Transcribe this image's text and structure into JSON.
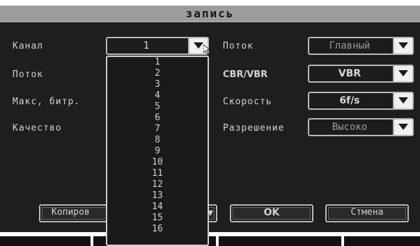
{
  "dialog": {
    "title": "запись"
  },
  "form": {
    "channel_label": "Канал",
    "channel_value": "1",
    "stream_label_left": "Поток",
    "max_bitrate_label": "Макс, битр.",
    "quality_label": "Качество",
    "stream_label_right": "Поток",
    "stream_value": "Главный",
    "cbr_vbr_label": "CBR/VBR",
    "cbr_vbr_value": "VBR",
    "speed_label": "Скорость",
    "speed_value": "6f/s",
    "resolution_label": "Разрешение",
    "resolution_value": "Высоко"
  },
  "channel_options": [
    "1",
    "2",
    "3",
    "4",
    "5",
    "6",
    "7",
    "8",
    "9",
    "10",
    "11",
    "12",
    "13",
    "14",
    "15",
    "16"
  ],
  "buttons": {
    "copy_label": "Копиров",
    "ok_label": "OK",
    "cancel_label": "Стмена"
  },
  "icons": {
    "dropdown_arrow": "chevron-down-icon",
    "cursor": "mouse-pointer-icon"
  }
}
